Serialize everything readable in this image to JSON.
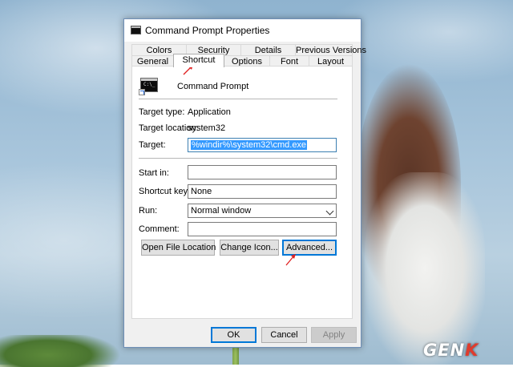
{
  "window": {
    "title": "Command Prompt Properties"
  },
  "tabs_top": [
    "Colors",
    "Security",
    "Details",
    "Previous Versions"
  ],
  "tabs_bottom": [
    "General",
    "Shortcut",
    "Options",
    "Font",
    "Layout"
  ],
  "active_tab": "Shortcut",
  "app": {
    "name": "Command Prompt",
    "icon": "cmd-app-icon"
  },
  "fields": {
    "target_type": {
      "label": "Target type:",
      "value": "Application"
    },
    "target_location": {
      "label": "Target location:",
      "value": "system32"
    },
    "target": {
      "label": "Target:",
      "value": "%windir%\\system32\\cmd.exe"
    },
    "start_in": {
      "label": "Start in:",
      "value": ""
    },
    "shortcut_key": {
      "label": "Shortcut key:",
      "value": "None"
    },
    "run": {
      "label": "Run:",
      "value": "Normal window"
    },
    "comment": {
      "label": "Comment:",
      "value": ""
    }
  },
  "buttons": {
    "open_file_location": "Open File Location",
    "change_icon": "Change Icon...",
    "advanced": "Advanced...",
    "ok": "OK",
    "cancel": "Cancel",
    "apply": "Apply"
  },
  "watermark": {
    "left": "GEN",
    "right": "K"
  },
  "colors": {
    "accent": "#0078d7",
    "selection": "#3399ff",
    "annotation_arrow": "#e02020"
  }
}
